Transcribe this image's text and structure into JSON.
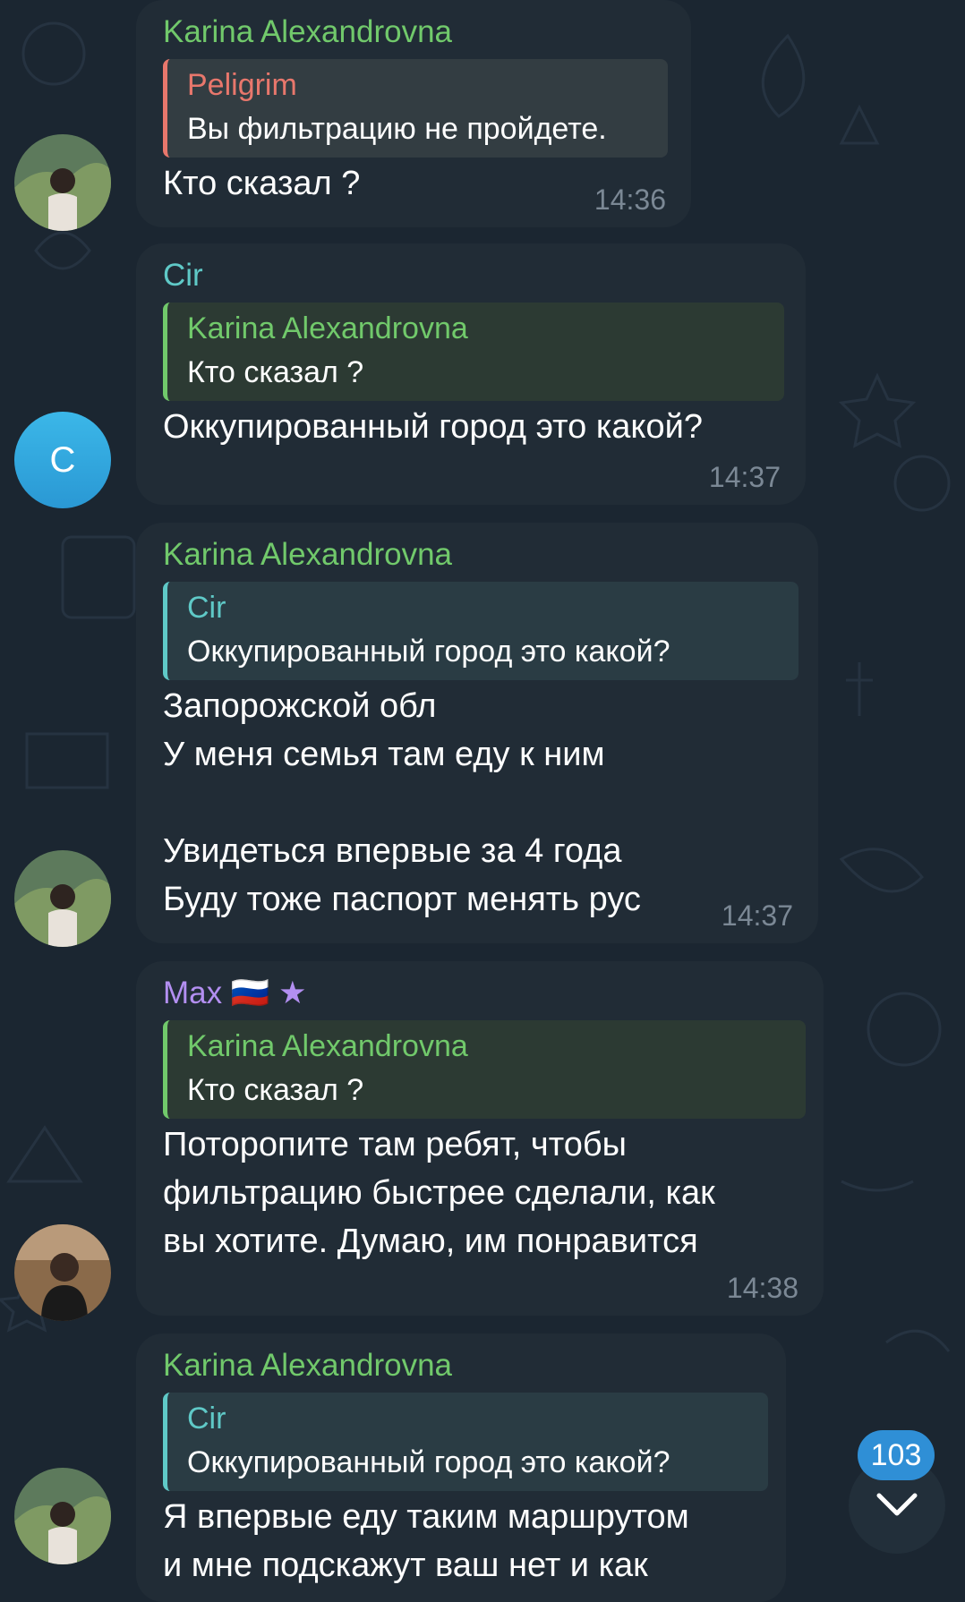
{
  "messages": [
    {
      "sender": "Karina Alexandrovna",
      "reply": {
        "name": "Peligrim",
        "text": "Вы фильтрацию не пройдете."
      },
      "text": "Кто сказал ?",
      "time": "14:36"
    },
    {
      "sender": "Cir",
      "avatar_letter": "C",
      "reply": {
        "name": "Karina Alexandrovna",
        "text": "Кто сказал ?"
      },
      "text": "Оккупированный город это какой?",
      "time": "14:37"
    },
    {
      "sender": "Karina Alexandrovna",
      "reply": {
        "name": "Cir",
        "text": "Оккупированный город это какой?"
      },
      "text": "Запорожской обл\nУ меня семья там еду к ним\n\nУвидеться впервые за 4 года\nБуду тоже паспорт менять рус",
      "time": "14:37"
    },
    {
      "sender": "Max 🇷🇺 ★",
      "reply": {
        "name": "Karina Alexandrovna",
        "text": "Кто сказал ?"
      },
      "text": "Поторопите там ребят, чтобы\nфильтрацию быстрее сделали, как\nвы хотите. Думаю, им понравится",
      "time": "14:38"
    },
    {
      "sender": "Karina Alexandrovna",
      "reply": {
        "name": "Cir",
        "text": "Оккупированный город это какой?"
      },
      "text": "Я впервые еду таким маршрутом\nи мне подскажут ваш нет и как",
      "time": ""
    }
  ],
  "unread_count": "103",
  "icons": {
    "scroll_down": "chevron-down-icon"
  },
  "colors": {
    "background": "#1b2631",
    "bubble": "#212c36",
    "karina": "#71c96b",
    "cir": "#5fc9c7",
    "max": "#b38ff1",
    "peligrim": "#e8776c",
    "time": "#7b8895",
    "badge": "#2f8fd6"
  }
}
